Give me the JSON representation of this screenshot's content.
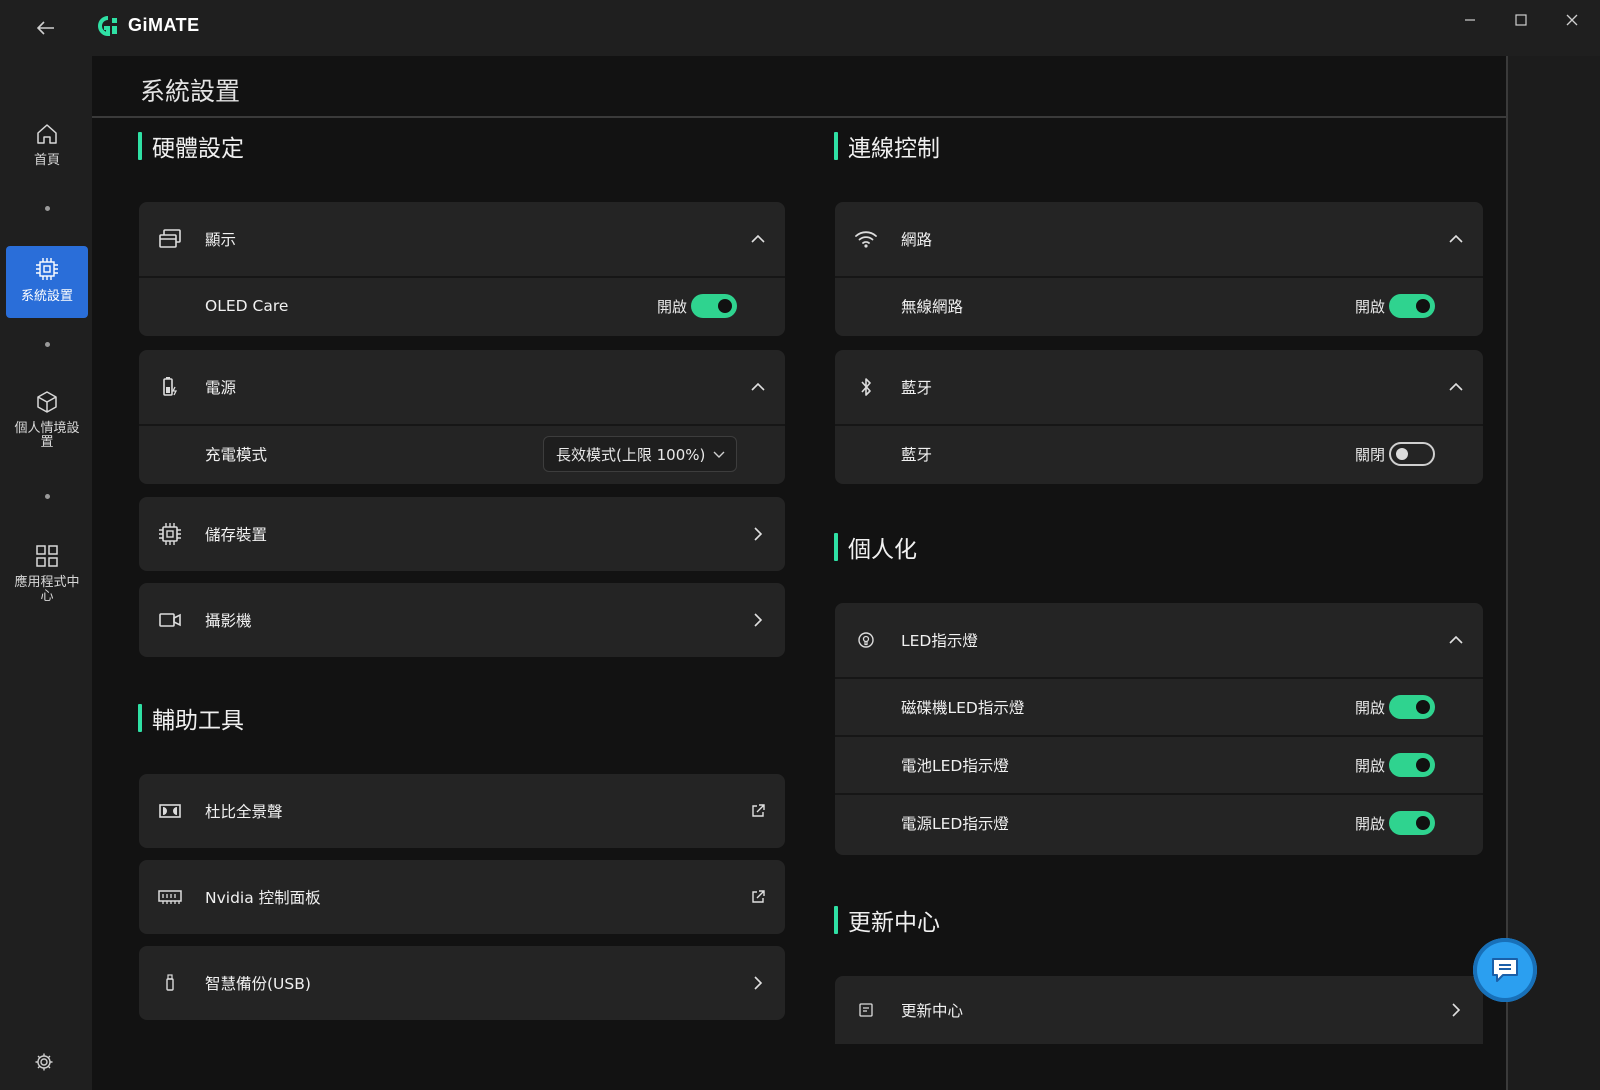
{
  "app": {
    "name": "GiMATE"
  },
  "window": {
    "back": "back",
    "minimize": "minimize",
    "maximize": "maximize",
    "close": "close"
  },
  "sidebar": {
    "items": [
      {
        "label": "首頁",
        "icon": "home-icon"
      },
      {
        "label": "系統設置",
        "icon": "chip-icon",
        "active": true
      },
      {
        "label": "個人情境設置",
        "icon": "cube-icon"
      },
      {
        "label": "應用程式中心",
        "icon": "grid-icon"
      }
    ]
  },
  "page": {
    "title": "系統設置"
  },
  "hardware": {
    "title": "硬體設定",
    "display": {
      "label": "顯示",
      "oled_label": "OLED Care",
      "oled_state": "開啟",
      "oled_on": true
    },
    "power": {
      "label": "電源",
      "charge_label": "充電模式",
      "charge_value": "長效模式(上限 100%)"
    },
    "storage": {
      "label": "儲存裝置"
    },
    "camera": {
      "label": "攝影機"
    }
  },
  "tools": {
    "title": "輔助工具",
    "dolby": {
      "label": "杜比全景聲"
    },
    "nvidia": {
      "label": "Nvidia 控制面板"
    },
    "backup": {
      "label": "智慧備份(USB)"
    }
  },
  "connection": {
    "title": "連線控制",
    "network": {
      "label": "網路",
      "wifi_label": "無線網路",
      "wifi_state": "開啟",
      "wifi_on": true
    },
    "bluetooth": {
      "label": "藍牙",
      "bt_label": "藍牙",
      "bt_state": "關閉",
      "bt_on": false
    }
  },
  "personal": {
    "title": "個人化",
    "led": {
      "label": "LED指示燈",
      "items": [
        {
          "label": "磁碟機LED指示燈",
          "state": "開啟",
          "on": true
        },
        {
          "label": "電池LED指示燈",
          "state": "開啟",
          "on": true
        },
        {
          "label": "電源LED指示燈",
          "state": "開啟",
          "on": true
        }
      ]
    }
  },
  "update": {
    "title": "更新中心",
    "center": {
      "label": "更新中心"
    }
  },
  "colors": {
    "accent": "#2fe0a4",
    "toggle_on": "#2fd38f",
    "nav_active": "#2a6ed9",
    "chat": "#2b9ff0"
  }
}
